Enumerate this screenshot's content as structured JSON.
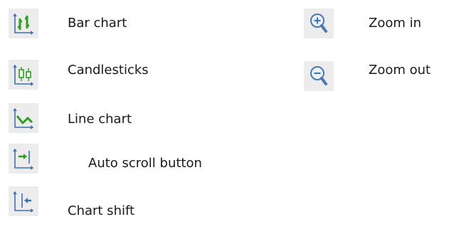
{
  "toolbar_legend": {
    "left_column": [
      {
        "icon": "bar-chart-icon",
        "label": "Bar chart"
      },
      {
        "icon": "candlesticks-icon",
        "label": "Candlesticks"
      },
      {
        "icon": "line-chart-icon",
        "label": "Line chart"
      },
      {
        "icon": "auto-scroll-icon",
        "label": "Auto scroll button"
      },
      {
        "icon": "chart-shift-icon",
        "label": "Chart shift"
      }
    ],
    "right_column": [
      {
        "icon": "zoom-in-icon",
        "label": "Zoom in"
      },
      {
        "icon": "zoom-out-icon",
        "label": "Zoom out"
      }
    ]
  },
  "colors": {
    "icon_background": "#ececec",
    "axis_blue": "#3d6fb5",
    "chart_green": "#2f9e1f",
    "magnifier_blue": "#4a78b0"
  }
}
